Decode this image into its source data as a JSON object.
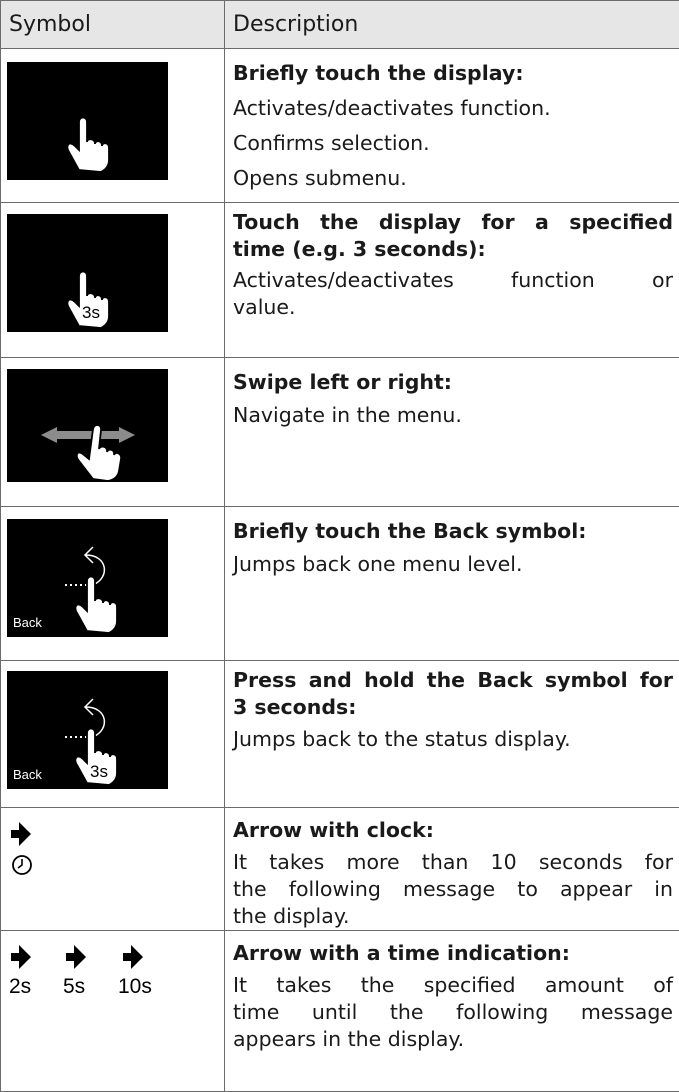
{
  "table": {
    "header": {
      "symbol": "Symbol",
      "description": "Description"
    },
    "rows": [
      {
        "title": "Briefly touch the display:",
        "lines": [
          "Activates/deactivates function.",
          "Confirms selection.",
          "Opens submenu."
        ]
      },
      {
        "title_l1": "Touch the display for a specified",
        "title_l2": "time (e.g. 3 seconds):",
        "body_l1": "Activates/deactivates function or",
        "body_l2": "value.",
        "badge": "3s"
      },
      {
        "title": "Swipe left or right:",
        "lines": [
          "Navigate in the menu."
        ]
      },
      {
        "title": "Briefly touch the Back symbol:",
        "lines": [
          "Jumps back one menu level."
        ],
        "screen_label": "Back"
      },
      {
        "title_l1": "Press and hold the Back symbol for",
        "title_l2": "3 seconds:",
        "lines": [
          "Jumps back to the status display."
        ],
        "screen_label": "Back",
        "badge": "3s"
      },
      {
        "title": "Arrow with clock:",
        "body_l1": "It takes more than 10 seconds for",
        "body_l2": "the following message to appear in",
        "body_l3": "the display."
      },
      {
        "title": "Arrow with a time indication:",
        "times": [
          "2s",
          "5s",
          "10s"
        ],
        "body_l1": "It takes the specified amount of",
        "body_l2": "time until the following message",
        "body_l3": "appears in the display."
      }
    ]
  }
}
